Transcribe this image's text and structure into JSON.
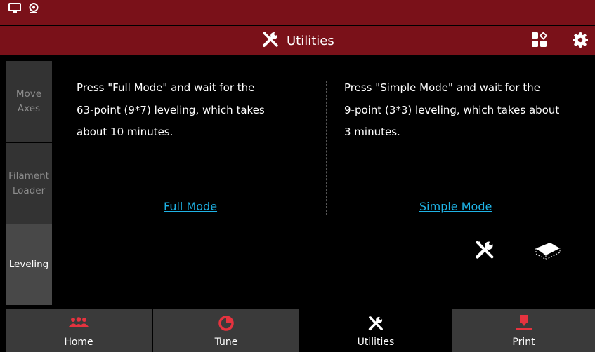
{
  "header": {
    "title": "Utilities",
    "title_icon": "wrench-screwdriver-icon",
    "status_icons": [
      "monitor-icon",
      "webcam-icon"
    ],
    "right_buttons": [
      "apps-grid-icon",
      "gear-icon"
    ],
    "bg_color": "#7a1119"
  },
  "sidebar": {
    "items": [
      {
        "label_line1": "Move",
        "label_line2": "Axes",
        "active": false
      },
      {
        "label_line1": "Filament",
        "label_line2": "Loader",
        "active": false
      },
      {
        "label_line1": "Leveling",
        "label_line2": "",
        "active": true
      }
    ]
  },
  "leveling": {
    "full": {
      "line1": "Press \"Full Mode\" and wait for the",
      "line2": "63-point (9*7) leveling, which takes",
      "line3": "about 10 minutes.",
      "link": "Full Mode"
    },
    "simple": {
      "line1": "Press \"Simple Mode\" and wait for the",
      "line2": "9-point (3*3) leveling, which takes about",
      "line3": "3 minutes.",
      "link": "Simple Mode"
    },
    "tools": [
      "wrench-screwdriver-icon",
      "bed-level-icon"
    ],
    "link_color": "#1fb3e6"
  },
  "bottom_nav": {
    "items": [
      {
        "label": "Home",
        "icon": "users-icon",
        "active": false
      },
      {
        "label": "Tune",
        "icon": "pie-icon",
        "active": false
      },
      {
        "label": "Utilities",
        "icon": "wrench-screwdriver-icon",
        "active": true
      },
      {
        "label": "Print",
        "icon": "print-head-icon",
        "active": false
      }
    ],
    "accent_color": "#e5333f"
  }
}
